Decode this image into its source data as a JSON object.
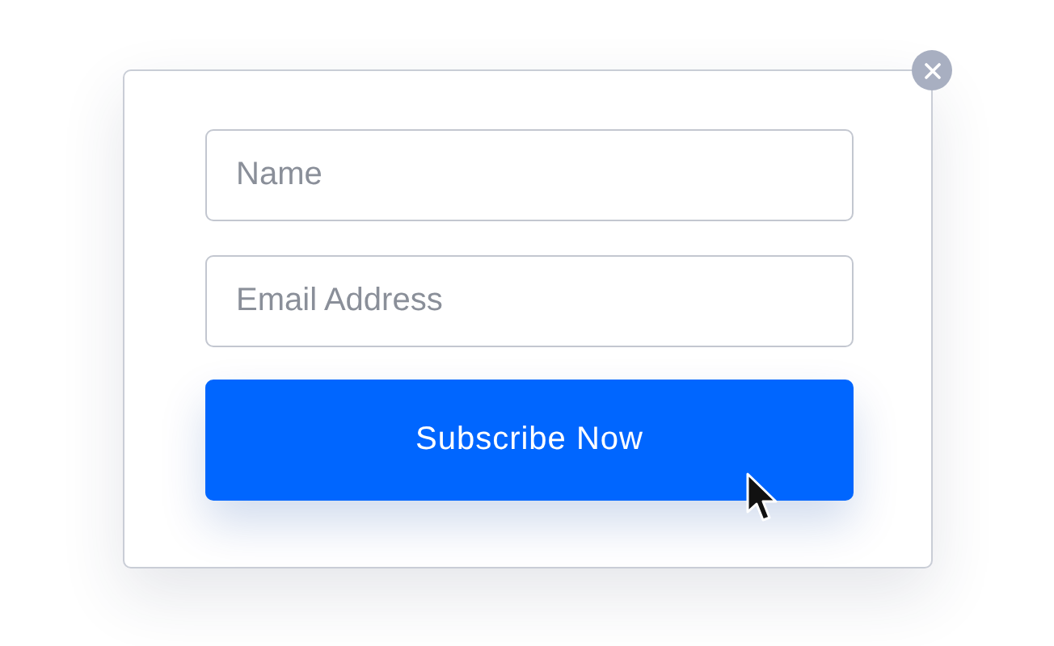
{
  "form": {
    "fields": [
      {
        "placeholder": "Name"
      },
      {
        "placeholder": "Email Address"
      }
    ],
    "submit_button": {
      "label": "Subscribe Now"
    }
  }
}
